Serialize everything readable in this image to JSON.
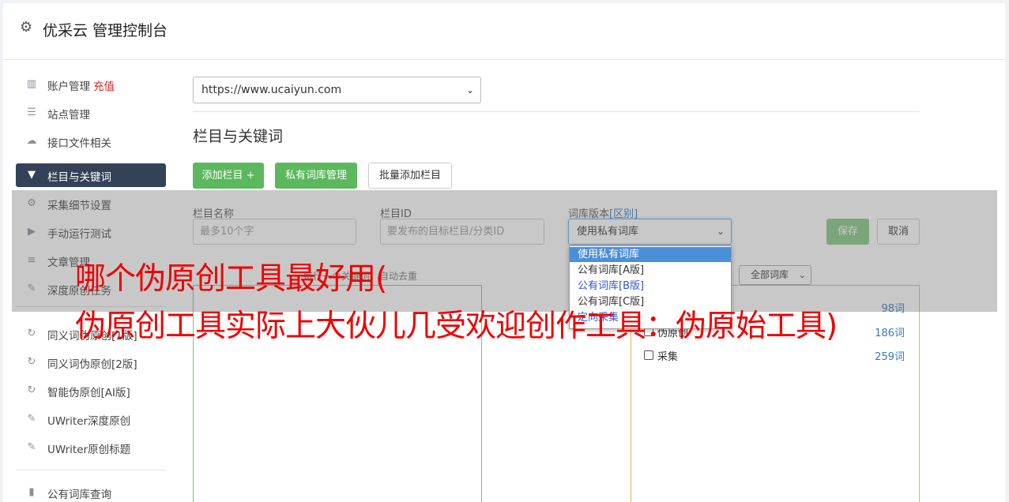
{
  "header": {
    "title": "优采云 管理控制台"
  },
  "sidebar": {
    "items": [
      {
        "label": "账户管理",
        "extra": "充值",
        "icon": "bar-chart-icon"
      },
      {
        "label": "站点管理",
        "icon": "server-icon"
      },
      {
        "label": "接口文件相关",
        "icon": "cloud-upload-icon"
      },
      {
        "label": "栏目与关键词",
        "icon": "filter-icon",
        "active": true
      },
      {
        "label": "采集细节设置",
        "icon": "gears-icon"
      },
      {
        "label": "手动运行测试",
        "icon": "play-circle-icon"
      },
      {
        "label": "文章管理",
        "icon": "database-icon"
      },
      {
        "label": "深度原创任务",
        "icon": "edit-icon"
      },
      {
        "label": "同义词伪原创[1版]",
        "icon": "refresh-icon"
      },
      {
        "label": "同义词伪原创[2版]",
        "icon": "refresh-icon"
      },
      {
        "label": "智能伪原创[AI版]",
        "icon": "refresh-icon"
      },
      {
        "label": "UWriter深度原创",
        "icon": "edit-icon"
      },
      {
        "label": "UWriter原创标题",
        "icon": "edit-icon"
      },
      {
        "label": "公有词库查询",
        "icon": "book-icon"
      }
    ]
  },
  "site_select": {
    "value": "https://www.ucaiyun.com"
  },
  "section": {
    "title": "栏目与关键词"
  },
  "buttons": {
    "add_column": "添加栏目 +",
    "private_lib": "私有词库管理",
    "batch_add": "批量添加栏目",
    "save": "保存",
    "cancel": "取消"
  },
  "form": {
    "column_name_label": "栏目名称",
    "column_name_placeholder": "最多10个字",
    "column_id_label": "栏目ID",
    "column_id_placeholder": "要发布的目标栏目/分类ID",
    "lib_version_label": "词库版本",
    "lib_version_link": "[区别]",
    "lib_version_value": "使用私有词库"
  },
  "dropdown": {
    "options": [
      {
        "label": "使用私有词库",
        "selected": true
      },
      {
        "label": "公有词库[A版]"
      },
      {
        "label": "公有词库[B版]",
        "blue": true
      },
      {
        "label": "公有词库[C版]"
      },
      {
        "label": "定向采集",
        "blue": true
      }
    ]
  },
  "hint": "每行一个关键词，自动去重",
  "mini_select": {
    "value": "全部词库"
  },
  "libraries": [
    {
      "name": "",
      "count": "98词"
    },
    {
      "name": "伪原创",
      "count": "186词"
    },
    {
      "name": "采集",
      "count": "259词"
    }
  ],
  "headline": {
    "line1": "哪个伪原创工具最好用(",
    "line2": "伪原创工具实际上大伙儿几受欢迎创作工具：伪原始工具)"
  },
  "colors": {
    "green": "#5cb85c",
    "nav_active": "#344258",
    "red_text": "#f00000",
    "link_blue": "#337ab7"
  }
}
